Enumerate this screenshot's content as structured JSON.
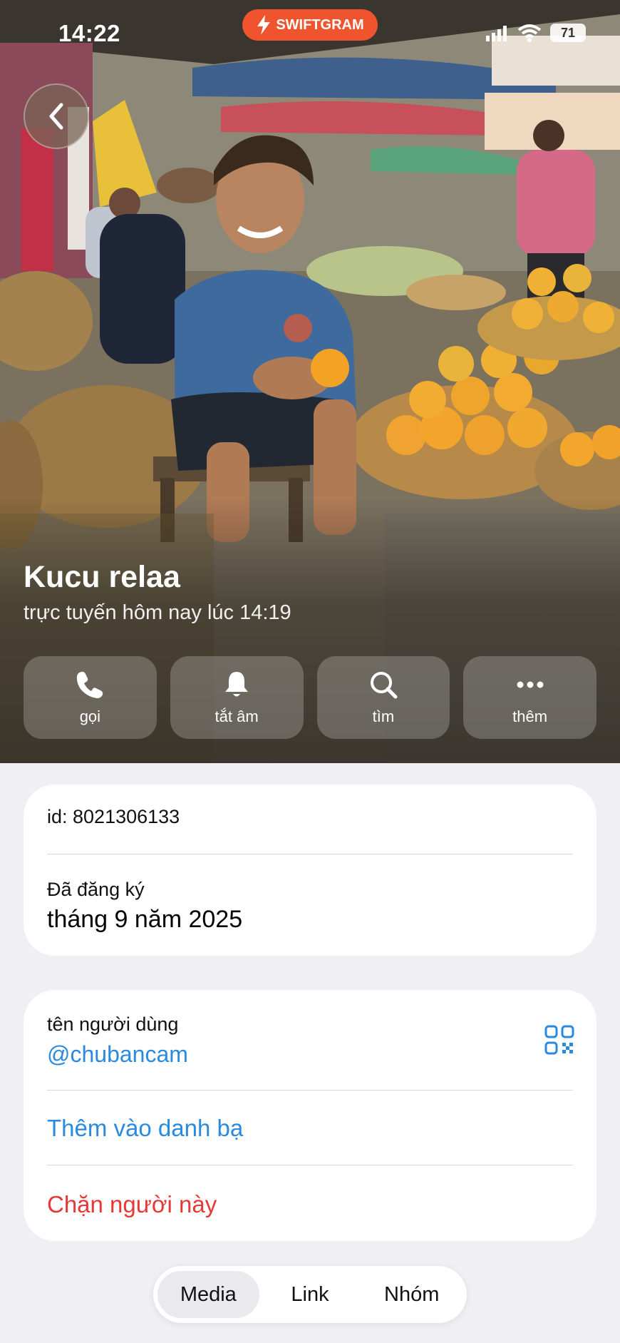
{
  "status_bar": {
    "time": "14:22",
    "battery": "71",
    "swiftgram_label": "SWIFTGRAM"
  },
  "profile": {
    "name": "Kucu relaa",
    "last_seen": "trực tuyến hôm nay lúc 14:19"
  },
  "actions": [
    {
      "label": "gọi",
      "icon": "phone-icon"
    },
    {
      "label": "tắt âm",
      "icon": "bell-icon"
    },
    {
      "label": "tìm",
      "icon": "search-icon"
    },
    {
      "label": "thêm",
      "icon": "more-icon"
    }
  ],
  "info_card": {
    "id_text": "id: 8021306133",
    "registered_label": "Đã đăng ký",
    "registered_value": "tháng 9 năm 2025"
  },
  "username_card": {
    "label": "tên người dùng",
    "value": "@chubancam",
    "add_contact": "Thêm vào danh bạ",
    "block": "Chặn người này"
  },
  "tabs": [
    {
      "label": "Media",
      "active": true
    },
    {
      "label": "Link",
      "active": false
    },
    {
      "label": "Nhóm",
      "active": false
    }
  ],
  "colors": {
    "link_blue": "#2a8ae0",
    "danger_red": "#e53935",
    "swiftgram_orange": "#f0542e"
  }
}
